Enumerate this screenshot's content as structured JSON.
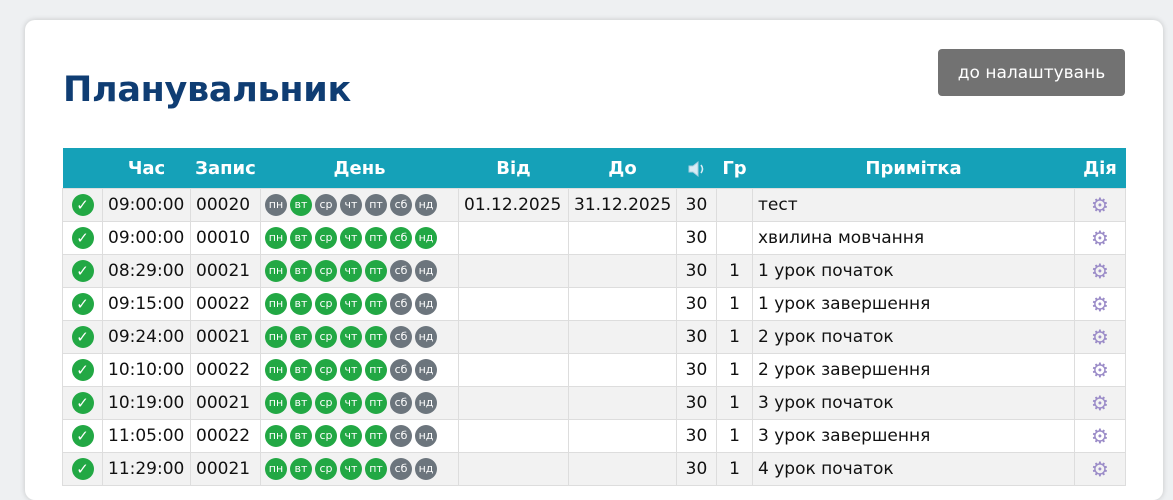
{
  "header": {
    "title": "Планувальник",
    "settings_button": "до налаштувань"
  },
  "table": {
    "columns": {
      "status": "",
      "time": "Час",
      "record": "Запис",
      "days": "День",
      "from": "Від",
      "to": "До",
      "volume_icon": "speaker-icon",
      "group": "Гр",
      "note": "Примітка",
      "action": "Дія"
    },
    "day_labels": [
      "пн",
      "вт",
      "ср",
      "чт",
      "пт",
      "сб",
      "нд"
    ],
    "colors": {
      "day_active": "#22a844",
      "day_inactive": "#6c757d",
      "header": "#15a1b8",
      "title": "#0f3d73"
    },
    "rows": [
      {
        "enabled": true,
        "time": "09:00:00",
        "record": "00020",
        "days": [
          false,
          true,
          false,
          false,
          false,
          false,
          false
        ],
        "from": "01.12.2025",
        "to": "31.12.2025",
        "volume": "30",
        "group": "",
        "note": "тест"
      },
      {
        "enabled": true,
        "time": "09:00:00",
        "record": "00010",
        "days": [
          true,
          true,
          true,
          true,
          true,
          true,
          true
        ],
        "from": "",
        "to": "",
        "volume": "30",
        "group": "",
        "note": "хвилина мовчання"
      },
      {
        "enabled": true,
        "time": "08:29:00",
        "record": "00021",
        "days": [
          true,
          true,
          true,
          true,
          true,
          false,
          false
        ],
        "from": "",
        "to": "",
        "volume": "30",
        "group": "1",
        "note": "1 урок початок"
      },
      {
        "enabled": true,
        "time": "09:15:00",
        "record": "00022",
        "days": [
          true,
          true,
          true,
          true,
          true,
          false,
          false
        ],
        "from": "",
        "to": "",
        "volume": "30",
        "group": "1",
        "note": "1 урок завершення"
      },
      {
        "enabled": true,
        "time": "09:24:00",
        "record": "00021",
        "days": [
          true,
          true,
          true,
          true,
          true,
          false,
          false
        ],
        "from": "",
        "to": "",
        "volume": "30",
        "group": "1",
        "note": "2 урок початок"
      },
      {
        "enabled": true,
        "time": "10:10:00",
        "record": "00022",
        "days": [
          true,
          true,
          true,
          true,
          true,
          false,
          false
        ],
        "from": "",
        "to": "",
        "volume": "30",
        "group": "1",
        "note": "2 урок завершення"
      },
      {
        "enabled": true,
        "time": "10:19:00",
        "record": "00021",
        "days": [
          true,
          true,
          true,
          true,
          true,
          false,
          false
        ],
        "from": "",
        "to": "",
        "volume": "30",
        "group": "1",
        "note": "3 урок початок"
      },
      {
        "enabled": true,
        "time": "11:05:00",
        "record": "00022",
        "days": [
          true,
          true,
          true,
          true,
          true,
          false,
          false
        ],
        "from": "",
        "to": "",
        "volume": "30",
        "group": "1",
        "note": "3 урок завершення"
      },
      {
        "enabled": true,
        "time": "11:29:00",
        "record": "00021",
        "days": [
          true,
          true,
          true,
          true,
          true,
          false,
          false
        ],
        "from": "",
        "to": "",
        "volume": "30",
        "group": "1",
        "note": "4 урок початок"
      }
    ]
  }
}
